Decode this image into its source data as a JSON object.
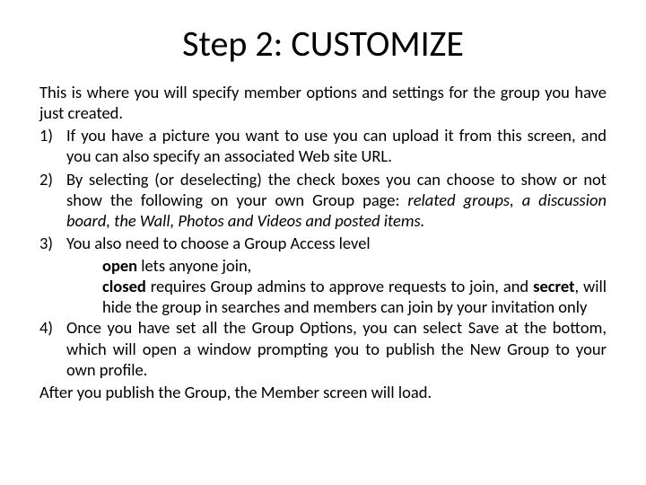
{
  "title": "Step 2: CUSTOMIZE",
  "intro": "This is where you will specify member options and settings for the group you have just created.",
  "items": [
    {
      "num": "1)",
      "text": "If you have a picture you want to use you can upload it from this screen, and you can also specify an associated Web site URL."
    },
    {
      "num": "2)",
      "lead": "By selecting (or deselecting) the check boxes you can choose to show or not show the following on your own Group page: ",
      "em": "related groups, a discussion board, the Wall, Photos and Videos and posted items."
    },
    {
      "num": "3)",
      "text": "You also need to choose a Group Access level"
    },
    {
      "num": "4)",
      "text": "Once you have set all the Group Options, you can select Save at the bottom, which will open a window prompting you to publish the New Group to your own profile."
    }
  ],
  "sub": [
    {
      "b": "open",
      "rest": " lets anyone join,"
    },
    {
      "b": "closed",
      "rest": " requires Group admins to approve requests to join, and "
    },
    {
      "b2": "secret",
      "rest2": ", will hide the group in searches and members can join by your invitation only"
    }
  ],
  "outro": "After you publish the Group, the Member screen will load."
}
